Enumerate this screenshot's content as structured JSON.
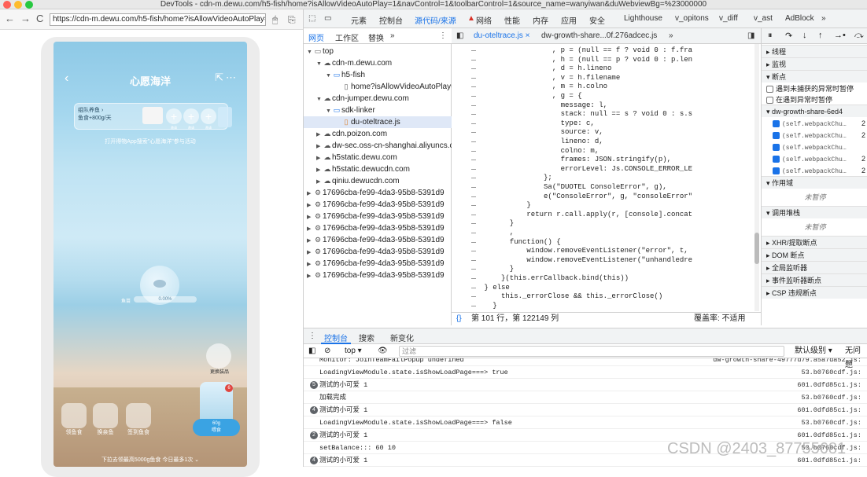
{
  "window": {
    "title": "DevTools - cdn-m.dewu.com/h5-fish/home?isAllowVideoAutoPlay=1&navControl=1&toolbarControl=1&source_name=wanyiwan&duWebviewBg=%23000000"
  },
  "browser": {
    "back": "←",
    "forward": "→",
    "reload": "C",
    "url": "https://cdn-m.dewu.com/h5-fish/home?isAllowVideoAutoPlay=1&navControl=1&toolbarControl=1"
  },
  "phone": {
    "title": "心愿海洋",
    "back": "‹",
    "team_text": "组队养鱼 ›\n鱼食+800g/天",
    "slots": [
      "+",
      "+",
      "+",
      "+"
    ],
    "slot_labels": [
      "邀请",
      "邀请",
      "邀请",
      "邀请"
    ],
    "hint": "打开得物App搜索\"心愿海洋\"参与活动",
    "progress_label": "鱼苗",
    "progress_text": "0.00%",
    "progress": 0.0,
    "reward_label": "更换装品",
    "bag_badge": "6",
    "feed_label": "60g\n喂食",
    "actions": [
      {
        "label": "领鱼食"
      },
      {
        "label": "换亲鱼"
      },
      {
        "label": "签到鱼食"
      }
    ],
    "bottom_hint": "下拉去领最高5000g鱼食 今日最多1次 ⌄"
  },
  "devtools": {
    "tabs": [
      "元素",
      "控制台",
      "源代码/来源",
      "网络",
      "性能",
      "内存",
      "应用",
      "安全",
      "Lighthouse",
      "v_opitons",
      "v_diff",
      "v_ast",
      "AdBlock",
      "»"
    ],
    "active_tab": "源代码/来源",
    "network_warning": "▲",
    "nav_tabs": [
      "网页",
      "工作区",
      "替换",
      "»"
    ],
    "tree": [
      {
        "label": "top",
        "indent": 0,
        "arrow": "▼",
        "icon": "▭",
        "kind": "frame"
      },
      {
        "label": "cdn-m.dewu.com",
        "indent": 1,
        "arrow": "▼",
        "icon": "☁",
        "kind": "cloud"
      },
      {
        "label": "h5-fish",
        "indent": 2,
        "arrow": "▼",
        "icon": "▭",
        "kind": "folder"
      },
      {
        "label": "home?isAllowVideoAutoPlay=1",
        "indent": 3,
        "arrow": "",
        "icon": "▯",
        "kind": "doc"
      },
      {
        "label": "cdn-jumper.dewu.com",
        "indent": 1,
        "arrow": "▼",
        "icon": "☁",
        "kind": "cloud"
      },
      {
        "label": "sdk-linker",
        "indent": 2,
        "arrow": "▼",
        "icon": "▭",
        "kind": "folder"
      },
      {
        "label": "du-oteltrace.js",
        "indent": 3,
        "arrow": "",
        "icon": "▯",
        "kind": "file",
        "selected": true
      },
      {
        "label": "cdn.poizon.com",
        "indent": 1,
        "arrow": "▶",
        "icon": "☁",
        "kind": "cloud"
      },
      {
        "label": "dw-sec.oss-cn-shanghai.aliyuncs.com",
        "indent": 1,
        "arrow": "▶",
        "icon": "☁",
        "kind": "cloud"
      },
      {
        "label": "h5static.dewu.com",
        "indent": 1,
        "arrow": "▶",
        "icon": "☁",
        "kind": "cloud"
      },
      {
        "label": "h5static.dewucdn.com",
        "indent": 1,
        "arrow": "▶",
        "icon": "☁",
        "kind": "cloud"
      },
      {
        "label": "qiniu.dewucdn.com",
        "indent": 1,
        "arrow": "▶",
        "icon": "☁",
        "kind": "cloud"
      },
      {
        "label": "17696cba-fe99-4da3-95b8-5391d9",
        "indent": 0,
        "arrow": "▶",
        "icon": "⚙",
        "kind": "worker"
      },
      {
        "label": "17696cba-fe99-4da3-95b8-5391d9",
        "indent": 0,
        "arrow": "▶",
        "icon": "⚙",
        "kind": "worker"
      },
      {
        "label": "17696cba-fe99-4da3-95b8-5391d9",
        "indent": 0,
        "arrow": "▶",
        "icon": "⚙",
        "kind": "worker"
      },
      {
        "label": "17696cba-fe99-4da3-95b8-5391d9",
        "indent": 0,
        "arrow": "▶",
        "icon": "⚙",
        "kind": "worker"
      },
      {
        "label": "17696cba-fe99-4da3-95b8-5391d9",
        "indent": 0,
        "arrow": "▶",
        "icon": "⚙",
        "kind": "worker"
      },
      {
        "label": "17696cba-fe99-4da3-95b8-5391d9",
        "indent": 0,
        "arrow": "▶",
        "icon": "⚙",
        "kind": "worker"
      },
      {
        "label": "17696cba-fe99-4da3-95b8-5391d9",
        "indent": 0,
        "arrow": "▶",
        "icon": "⚙",
        "kind": "worker"
      },
      {
        "label": "17696cba-fe99-4da3-95b8-5391d9",
        "indent": 0,
        "arrow": "▶",
        "icon": "⚙",
        "kind": "worker"
      }
    ],
    "editor_tabs": [
      {
        "label": "du-oteltrace.js",
        "close": "×",
        "active": true
      },
      {
        "label": "dw-growth-share...0f.276adcec.js",
        "close": "",
        "active": false
      },
      {
        "label": "»",
        "close": "",
        "active": false
      }
    ],
    "code_lines": [
      "                 , p = (null == f ? void 0 : f.fra",
      "                 , h = (null == p ? void 0 : p.len",
      "                 , d = h.lineno",
      "                 , v = h.filename",
      "                 , m = h.colno",
      "                 , g = {",
      "                   message: l,",
      "                   stack: null == s ? void 0 : s.s",
      "                   type: c,",
      "                   source: v,",
      "                   lineno: d,",
      "                   colno: m,",
      "                   frames: JSON.stringify(p),",
      "                   errorLevel: Js.CONSOLE_ERROR_LE",
      "               };",
      "               Sa(\"DUOTEL ConsoleError\", g),",
      "               e(\"ConsoleError\", g, \"consoleError\"",
      "           }",
      "           return r.call.apply(r, [console].concat",
      "       }",
      "       ,",
      "       function() {",
      "           window.removeEventListener(\"error\", t,",
      "           window.removeEventListener(\"unhandledre",
      "       }",
      "     }(this.errCallback.bind(this))",
      " } else",
      "     this._errorClose && this._errorClose()",
      "   }"
    ],
    "status_pos": "第 101 行，第 122149 列",
    "status_coverage": "覆盖率: 不适用",
    "status_braces": "{}",
    "right_toolbar": [
      "⏸",
      "↷",
      "↓",
      "↑",
      "→•",
      "⤼"
    ],
    "right_sections": [
      {
        "type": "head",
        "text": "▸ 线程"
      },
      {
        "type": "head",
        "text": "▸ 监视"
      },
      {
        "type": "head",
        "text": "▾ 断点"
      },
      {
        "type": "check",
        "text": "遇到未捕获的异常时暂停",
        "on": false
      },
      {
        "type": "check",
        "text": "在遇到异常时暂停",
        "on": false
      },
      {
        "type": "file",
        "text": "▾ dw-growth-share-6ed4"
      },
      {
        "type": "bp",
        "text": "(self.webpackChu…",
        "on": true,
        "n": "2"
      },
      {
        "type": "bp",
        "text": "(self.webpackChu…",
        "on": true,
        "n": "2"
      },
      {
        "type": "bp",
        "text": "(self.webpackChu…",
        "on": true,
        "n": ""
      },
      {
        "type": "bp",
        "text": "(self.webpackChu…",
        "on": true,
        "n": "2"
      },
      {
        "type": "bp",
        "text": "(self.webpackChu…",
        "on": true,
        "n": "2"
      },
      {
        "type": "head",
        "text": "▾ 作用域"
      },
      {
        "type": "muted",
        "text": "未暂停"
      },
      {
        "type": "head",
        "text": "▾ 调用堆栈"
      },
      {
        "type": "muted",
        "text": "未暂停"
      },
      {
        "type": "head",
        "text": "▸ XHR/提取断点"
      },
      {
        "type": "head",
        "text": "▸ DOM 断点"
      },
      {
        "type": "head",
        "text": "▸ 全局监听器"
      },
      {
        "type": "head",
        "text": "▸ 事件监听器断点"
      },
      {
        "type": "head",
        "text": "▸ CSP 违规断点"
      }
    ],
    "console_tabs": [
      "控制台",
      "搜索",
      "新变化"
    ],
    "console_toolbar": {
      "context": "top ▾",
      "filter_placeholder": "过滤",
      "level": "默认级别 ▾",
      "issues": "无问题"
    },
    "console_messages": [
      {
        "badge": "",
        "text": "Monitor: JoinTeamFailPopup undefined",
        "src": "dw-growth-share-49777d79.a5a7da52.js:"
      },
      {
        "badge": "",
        "text": "LoadingViewModule.state.isShowLoadPage===> true",
        "src": "53.b0760cdf.js:"
      },
      {
        "badge": "5",
        "text": "测试的小可爱 1",
        "src": "601.0dfd85c1.js:"
      },
      {
        "badge": "",
        "text": "加载完成",
        "src": "53.b0760cdf.js:"
      },
      {
        "badge": "4",
        "text": "测试的小可爱 1",
        "src": "601.0dfd85c1.js:"
      },
      {
        "badge": "",
        "text": "LoadingViewModule.state.isShowLoadPage===> false",
        "src": "53.b0760cdf.js:"
      },
      {
        "badge": "2",
        "text": "测试的小可爱 1",
        "src": "601.0dfd85c1.js:"
      },
      {
        "badge": "",
        "text": "setBalance::: 60 10",
        "src": "53.b0760cdf.js:"
      },
      {
        "badge": "4",
        "text": "测试的小可爱 1",
        "src": "601.0dfd85c1.js:"
      }
    ],
    "watermark": "CSDN @2403_87755681"
  },
  "colors": {
    "accent": "#1a73e8",
    "selected_row": "#dfe8f7",
    "feed_button": "#3aa3e3",
    "badge_red": "#e0453f"
  }
}
